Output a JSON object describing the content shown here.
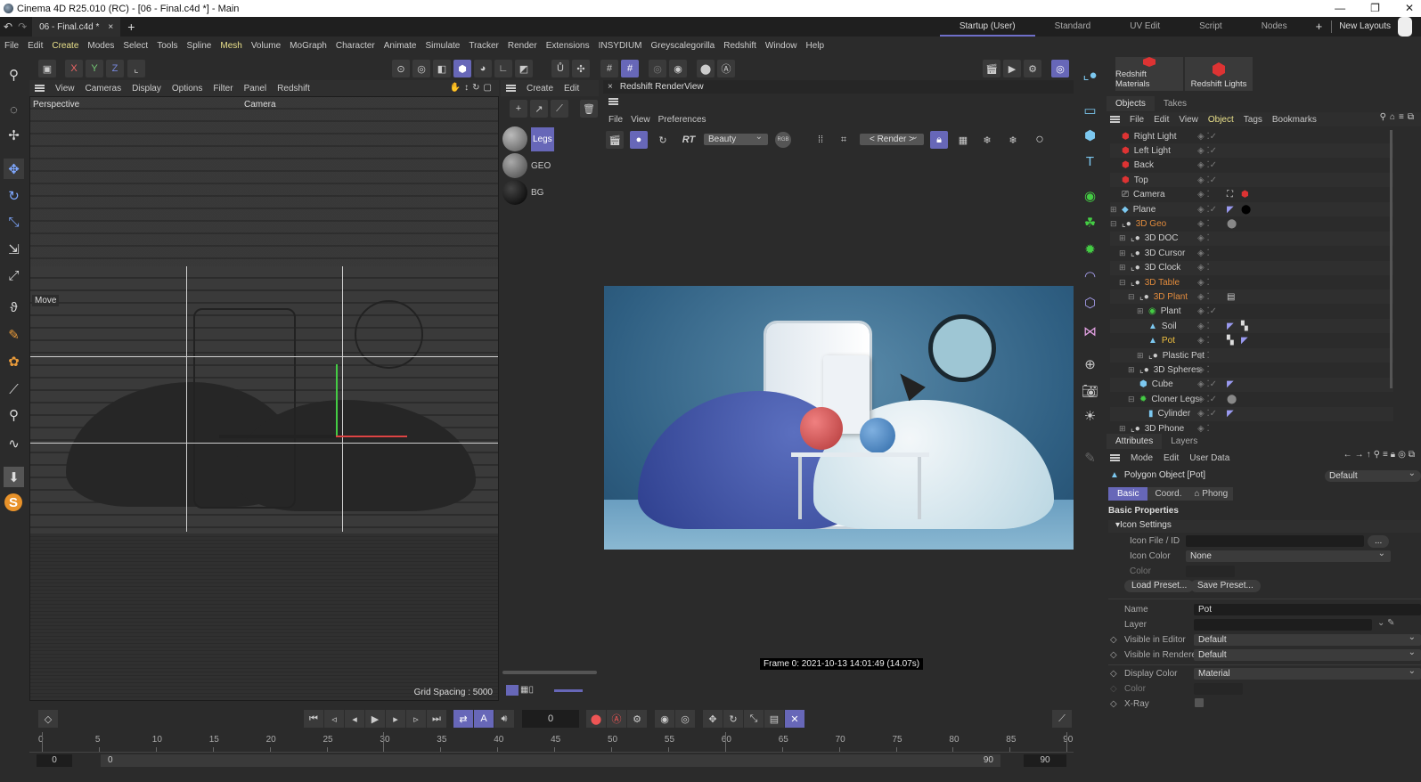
{
  "window": {
    "title": "Cinema 4D R25.010 (RC) - [06 - Final.c4d *] - Main",
    "controls": [
      "—",
      "❐",
      "✕"
    ]
  },
  "tabs": {
    "document": "06 - Final.c4d *",
    "close": "×",
    "add": "+"
  },
  "layouts": {
    "items": [
      "Startup (User)",
      "Standard",
      "UV Edit",
      "Script",
      "Nodes"
    ],
    "active": "Startup (User)",
    "add": "+",
    "new_layouts": "New Layouts"
  },
  "menu": [
    "File",
    "Edit",
    "Create",
    "Modes",
    "Select",
    "Tools",
    "Spline",
    "Mesh",
    "Volume",
    "MoGraph",
    "Character",
    "Animate",
    "Simulate",
    "Tracker",
    "Render",
    "Extensions",
    "INSYDIUM",
    "Greyscalegorilla",
    "Redshift",
    "Window",
    "Help"
  ],
  "menu_highlight": [
    "Create",
    "Mesh"
  ],
  "axis_buttons": [
    "X",
    "Y",
    "Z"
  ],
  "viewport": {
    "menu": [
      "View",
      "Cameras",
      "Display",
      "Options",
      "Filter",
      "Panel",
      "Redshift"
    ],
    "label": "Perspective",
    "camera": "Camera",
    "tool": "Move",
    "grid": "Grid Spacing : 5000"
  },
  "materials": {
    "menu": [
      "Create",
      "Edit"
    ],
    "items": [
      {
        "name": "Legs",
        "selected": true
      },
      {
        "name": "GEO"
      },
      {
        "name": "BG"
      }
    ]
  },
  "renderview": {
    "title": "Redshift RenderView",
    "menu": [
      "File",
      "View",
      "Preferences"
    ],
    "rt": "RT",
    "aov": "Beauty",
    "rgb": "RGB",
    "camera": "< Render >",
    "status": "Frame 0:  2021-10-13  14:01:49  (14.07s)"
  },
  "redshift_buttons": [
    "Redshift Materials",
    "Redshift Lights"
  ],
  "objects": {
    "tabs": [
      "Objects",
      "Takes"
    ],
    "menu": [
      "File",
      "Edit",
      "View",
      "Object",
      "Tags",
      "Bookmarks"
    ],
    "rows": [
      {
        "name": "Right Light",
        "level": 0,
        "icon": "light",
        "check": true
      },
      {
        "name": "Left Light",
        "level": 0,
        "icon": "light",
        "check": true
      },
      {
        "name": "Back",
        "level": 0,
        "icon": "light",
        "check": true
      },
      {
        "name": "Top",
        "level": 0,
        "icon": "light",
        "check": true
      },
      {
        "name": "Camera",
        "level": 0,
        "icon": "camera",
        "tags": [
          "target",
          "rs-camera"
        ]
      },
      {
        "name": "Plane",
        "level": 0,
        "icon": "plane",
        "expand": "+",
        "check": true,
        "tags": [
          "uv",
          "mat-black"
        ]
      },
      {
        "name": "3D Geo",
        "level": 0,
        "icon": "null",
        "expand": "-",
        "color": "orange",
        "tags": [
          "mat-grey"
        ]
      },
      {
        "name": "3D DOC",
        "level": 1,
        "icon": "null",
        "expand": "+"
      },
      {
        "name": "3D Cursor",
        "level": 1,
        "icon": "null",
        "expand": "+"
      },
      {
        "name": "3D Clock",
        "level": 1,
        "icon": "null",
        "expand": "+"
      },
      {
        "name": "3D Table",
        "level": 1,
        "icon": "null",
        "expand": "-",
        "color": "orange"
      },
      {
        "name": "3D Plant",
        "level": 2,
        "icon": "null",
        "expand": "-",
        "color": "orange",
        "tags": [
          "note"
        ]
      },
      {
        "name": "Plant",
        "level": 3,
        "icon": "generator",
        "expand": "+",
        "check": true
      },
      {
        "name": "Soil",
        "level": 3,
        "icon": "poly",
        "tags": [
          "uv",
          "checker"
        ]
      },
      {
        "name": "Pot",
        "level": 3,
        "icon": "poly",
        "color": "selected",
        "tags": [
          "checker",
          "uv"
        ]
      },
      {
        "name": "Plastic Pot",
        "level": 3,
        "icon": "null",
        "expand": "+"
      },
      {
        "name": "3D Spheres",
        "level": 2,
        "icon": "null",
        "expand": "+"
      },
      {
        "name": "Cube",
        "level": 2,
        "icon": "cube",
        "check": true,
        "tags": [
          "uv"
        ]
      },
      {
        "name": "Cloner Legs",
        "level": 2,
        "icon": "cloner",
        "expand": "-",
        "check": true,
        "tags": [
          "mat-grey"
        ]
      },
      {
        "name": "Cylinder",
        "level": 3,
        "icon": "cylinder",
        "check": true,
        "tags": [
          "uv"
        ]
      },
      {
        "name": "3D Phone",
        "level": 1,
        "icon": "null",
        "expand": "+"
      }
    ]
  },
  "attributes": {
    "tabs": [
      "Attributes",
      "Layers"
    ],
    "menu": [
      "Mode",
      "Edit",
      "User Data"
    ],
    "object": "Polygon Object [Pot]",
    "preset": "Default",
    "subtabs": [
      "Basic",
      "Coord.",
      "Phong"
    ],
    "section": "Basic Properties",
    "group": "Icon Settings",
    "icon_file_label": "Icon File / ID",
    "icon_file_btn": "...",
    "icon_color_label": "Icon Color",
    "icon_color": "None",
    "color_label": "Color",
    "load_preset": "Load Preset...",
    "save_preset": "Save Preset...",
    "name_label": "Name",
    "name": "Pot",
    "layer_label": "Layer",
    "layer": "",
    "vis_editor_label": "Visible in Editor",
    "vis_editor": "Default",
    "vis_render_label": "Visible in Renderer",
    "vis_render": "Default",
    "display_color_label": "Display Color",
    "display_color": "Material",
    "color2_label": "Color",
    "xray_label": "X-Ray",
    "xray": false
  },
  "timeline": {
    "current_frame": "0",
    "start": "0",
    "end": "90",
    "range_start": "0",
    "range_end": "90",
    "ticks": [
      "0",
      "5",
      "10",
      "15",
      "20",
      "25",
      "30",
      "35",
      "40",
      "45",
      "50",
      "55",
      "60",
      "65",
      "70",
      "75",
      "80",
      "85",
      "90"
    ]
  },
  "colors": {
    "accent": "#6767b8",
    "orange": "#e08a3c",
    "selected": "#f0c040",
    "light_red": "#d33"
  }
}
